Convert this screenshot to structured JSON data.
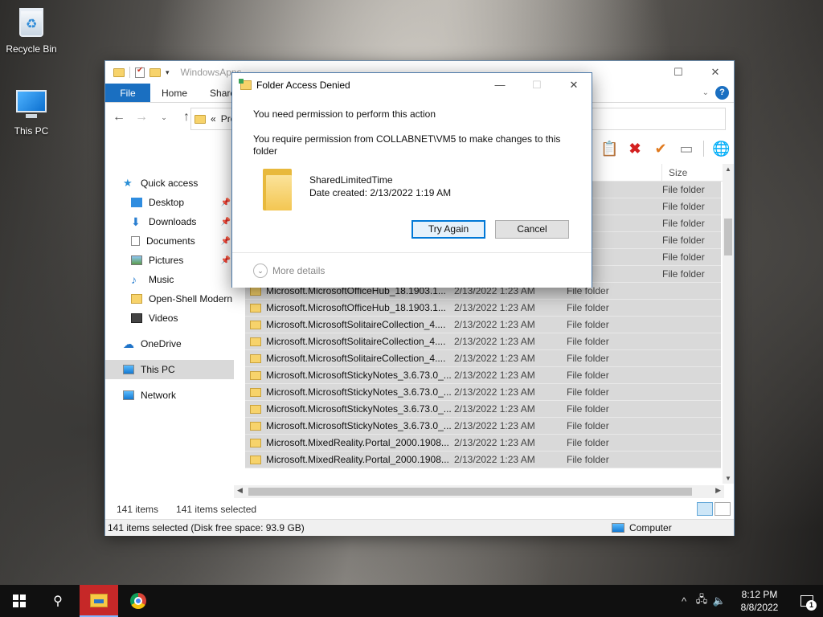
{
  "desktop": {
    "icons": [
      {
        "label": "Recycle Bin",
        "icon": "recycle-bin-icon"
      },
      {
        "label": "This PC",
        "icon": "computer-icon"
      }
    ]
  },
  "explorer": {
    "title": "WindowsApps",
    "ribbon_tabs": [
      "File",
      "Home",
      "Share"
    ],
    "address_prefix": "«",
    "address_text": "Pro",
    "column_size": "Size",
    "nav": {
      "quick_access": "Quick access",
      "desktop": "Desktop",
      "downloads": "Downloads",
      "documents": "Documents",
      "pictures": "Pictures",
      "music": "Music",
      "open_shell": "Open-Shell Modern",
      "videos": "Videos",
      "onedrive": "OneDrive",
      "this_pc": "This PC",
      "network": "Network"
    },
    "hidden_rows_type": "File folder",
    "rows": [
      {
        "name": "Microsoft.MicrosoftOfficeHub_18.1903.1...",
        "date": "2/13/2022 1:23 AM",
        "type": "File folder"
      },
      {
        "name": "Microsoft.MicrosoftOfficeHub_18.1903.1...",
        "date": "2/13/2022 1:23 AM",
        "type": "File folder"
      },
      {
        "name": "Microsoft.MicrosoftSolitaireCollection_4....",
        "date": "2/13/2022 1:23 AM",
        "type": "File folder"
      },
      {
        "name": "Microsoft.MicrosoftSolitaireCollection_4....",
        "date": "2/13/2022 1:23 AM",
        "type": "File folder"
      },
      {
        "name": "Microsoft.MicrosoftSolitaireCollection_4....",
        "date": "2/13/2022 1:23 AM",
        "type": "File folder"
      },
      {
        "name": "Microsoft.MicrosoftStickyNotes_3.6.73.0_...",
        "date": "2/13/2022 1:23 AM",
        "type": "File folder"
      },
      {
        "name": "Microsoft.MicrosoftStickyNotes_3.6.73.0_...",
        "date": "2/13/2022 1:23 AM",
        "type": "File folder"
      },
      {
        "name": "Microsoft.MicrosoftStickyNotes_3.6.73.0_...",
        "date": "2/13/2022 1:23 AM",
        "type": "File folder"
      },
      {
        "name": "Microsoft.MicrosoftStickyNotes_3.6.73.0_...",
        "date": "2/13/2022 1:23 AM",
        "type": "File folder"
      },
      {
        "name": "Microsoft.MixedReality.Portal_2000.1908...",
        "date": "2/13/2022 1:23 AM",
        "type": "File folder"
      },
      {
        "name": "Microsoft.MixedReality.Portal_2000.1908...",
        "date": "2/13/2022 1:23 AM",
        "type": "File folder"
      }
    ],
    "status_count": "141 items",
    "status_selected": "141 items selected",
    "status_bar": "141 items selected (Disk free space: 93.9 GB)",
    "status_location": "Computer"
  },
  "dialog": {
    "title": "Folder Access Denied",
    "message1": "You need permission to perform this action",
    "message2": "You require permission from COLLABNET\\VM5 to make changes to this folder",
    "folder_name": "SharedLimitedTime",
    "date_created": "Date created: 2/13/2022 1:19 AM",
    "try_again": "Try Again",
    "cancel": "Cancel",
    "more_details": "More details"
  },
  "taskbar": {
    "time": "8:12 PM",
    "date": "8/8/2022",
    "notification_count": "1"
  }
}
